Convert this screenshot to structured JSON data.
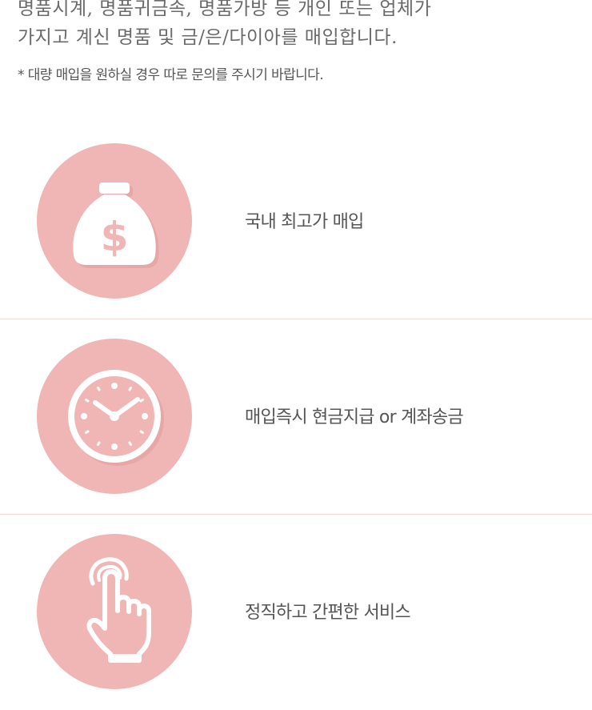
{
  "intro": {
    "line1": "명품시계, 명품귀금속, 명품가방 등 개인 또는 업체가",
    "line2": "가지고 계신 명품 및 금/은/다이아를 매입합니다.",
    "note": "* 대량 매입을 원하실 경우 따로 문의를 주시기 바랍니다."
  },
  "features": [
    {
      "icon": "money-bag-icon",
      "label": "국내 최고가 매입"
    },
    {
      "icon": "clock-icon",
      "label": "매입즉시 현금지급 or 계좌송금"
    },
    {
      "icon": "pointing-hand-icon",
      "label": "정직하고 간편한 서비스"
    }
  ],
  "colors": {
    "circle": "#f0b6b5",
    "divider": "#f2d9d8",
    "text": "#555555"
  }
}
